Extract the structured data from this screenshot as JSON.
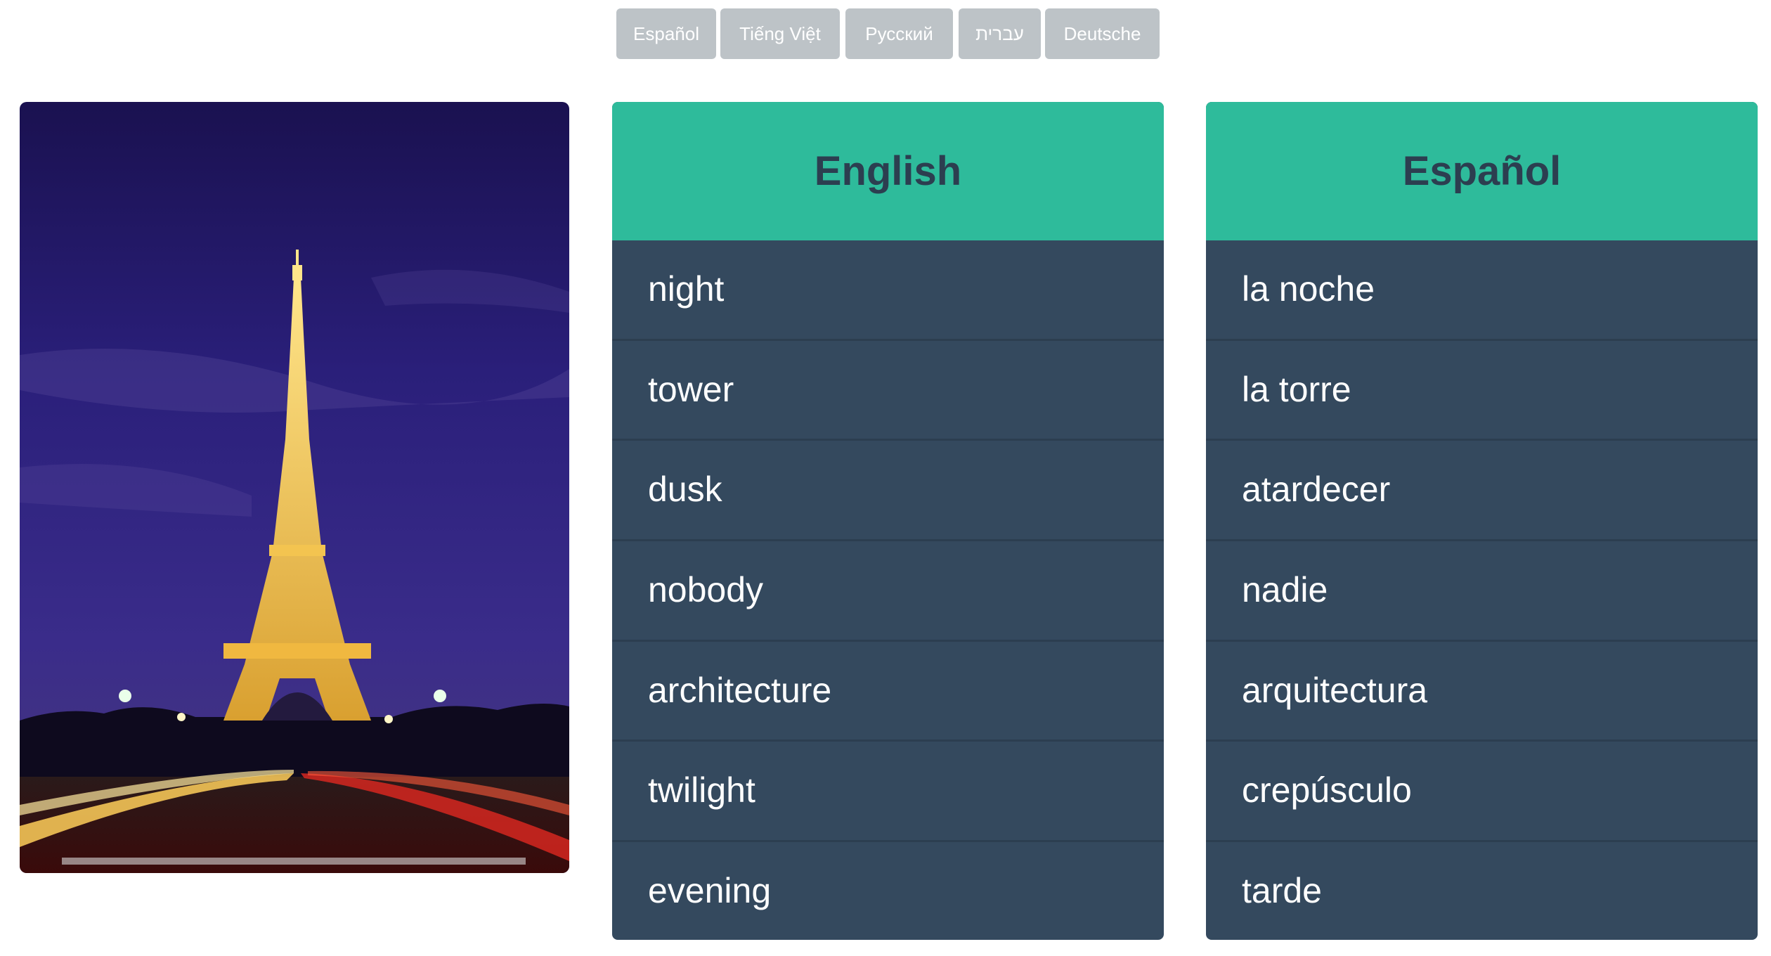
{
  "languages": [
    "Español",
    "Tiếng Việt",
    "Русский",
    "עברית",
    "Deutsche"
  ],
  "photo": {
    "alt": "Eiffel Tower at night"
  },
  "english_panel": {
    "title": "English",
    "words": [
      "night",
      "tower",
      "dusk",
      "nobody",
      "architecture",
      "twilight",
      "evening"
    ]
  },
  "spanish_panel": {
    "title": "Español",
    "words": [
      "la noche",
      "la torre",
      "atardecer",
      "nadie",
      "arquitectura",
      "crepúsculo",
      "tarde"
    ]
  },
  "colors": {
    "header": "#2ebb9b",
    "list_bg": "#34495e",
    "header_text": "#2c3e50",
    "button_bg": "#bdc3c7"
  }
}
